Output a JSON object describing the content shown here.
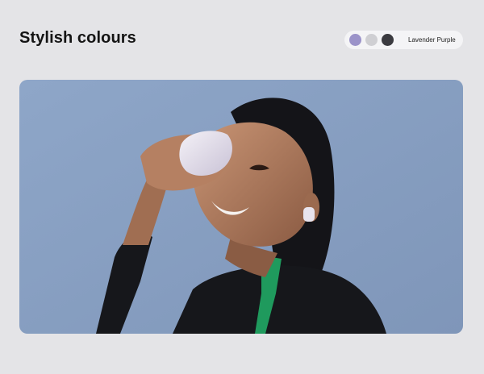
{
  "section": {
    "title": "Stylish colours"
  },
  "color_picker": {
    "swatches": [
      {
        "name": "lavender",
        "color": "#9b93c9",
        "selected": true
      },
      {
        "name": "light-grey",
        "color": "#cfcfd3",
        "selected": false
      },
      {
        "name": "dark-grey",
        "color": "#3b3b40",
        "selected": false
      }
    ],
    "selected_label": "Lavender Purple"
  },
  "hero": {
    "background_color": "#8fa5c6",
    "accent_color": "#1f9a5d",
    "product_color": "#e8e4ee"
  }
}
